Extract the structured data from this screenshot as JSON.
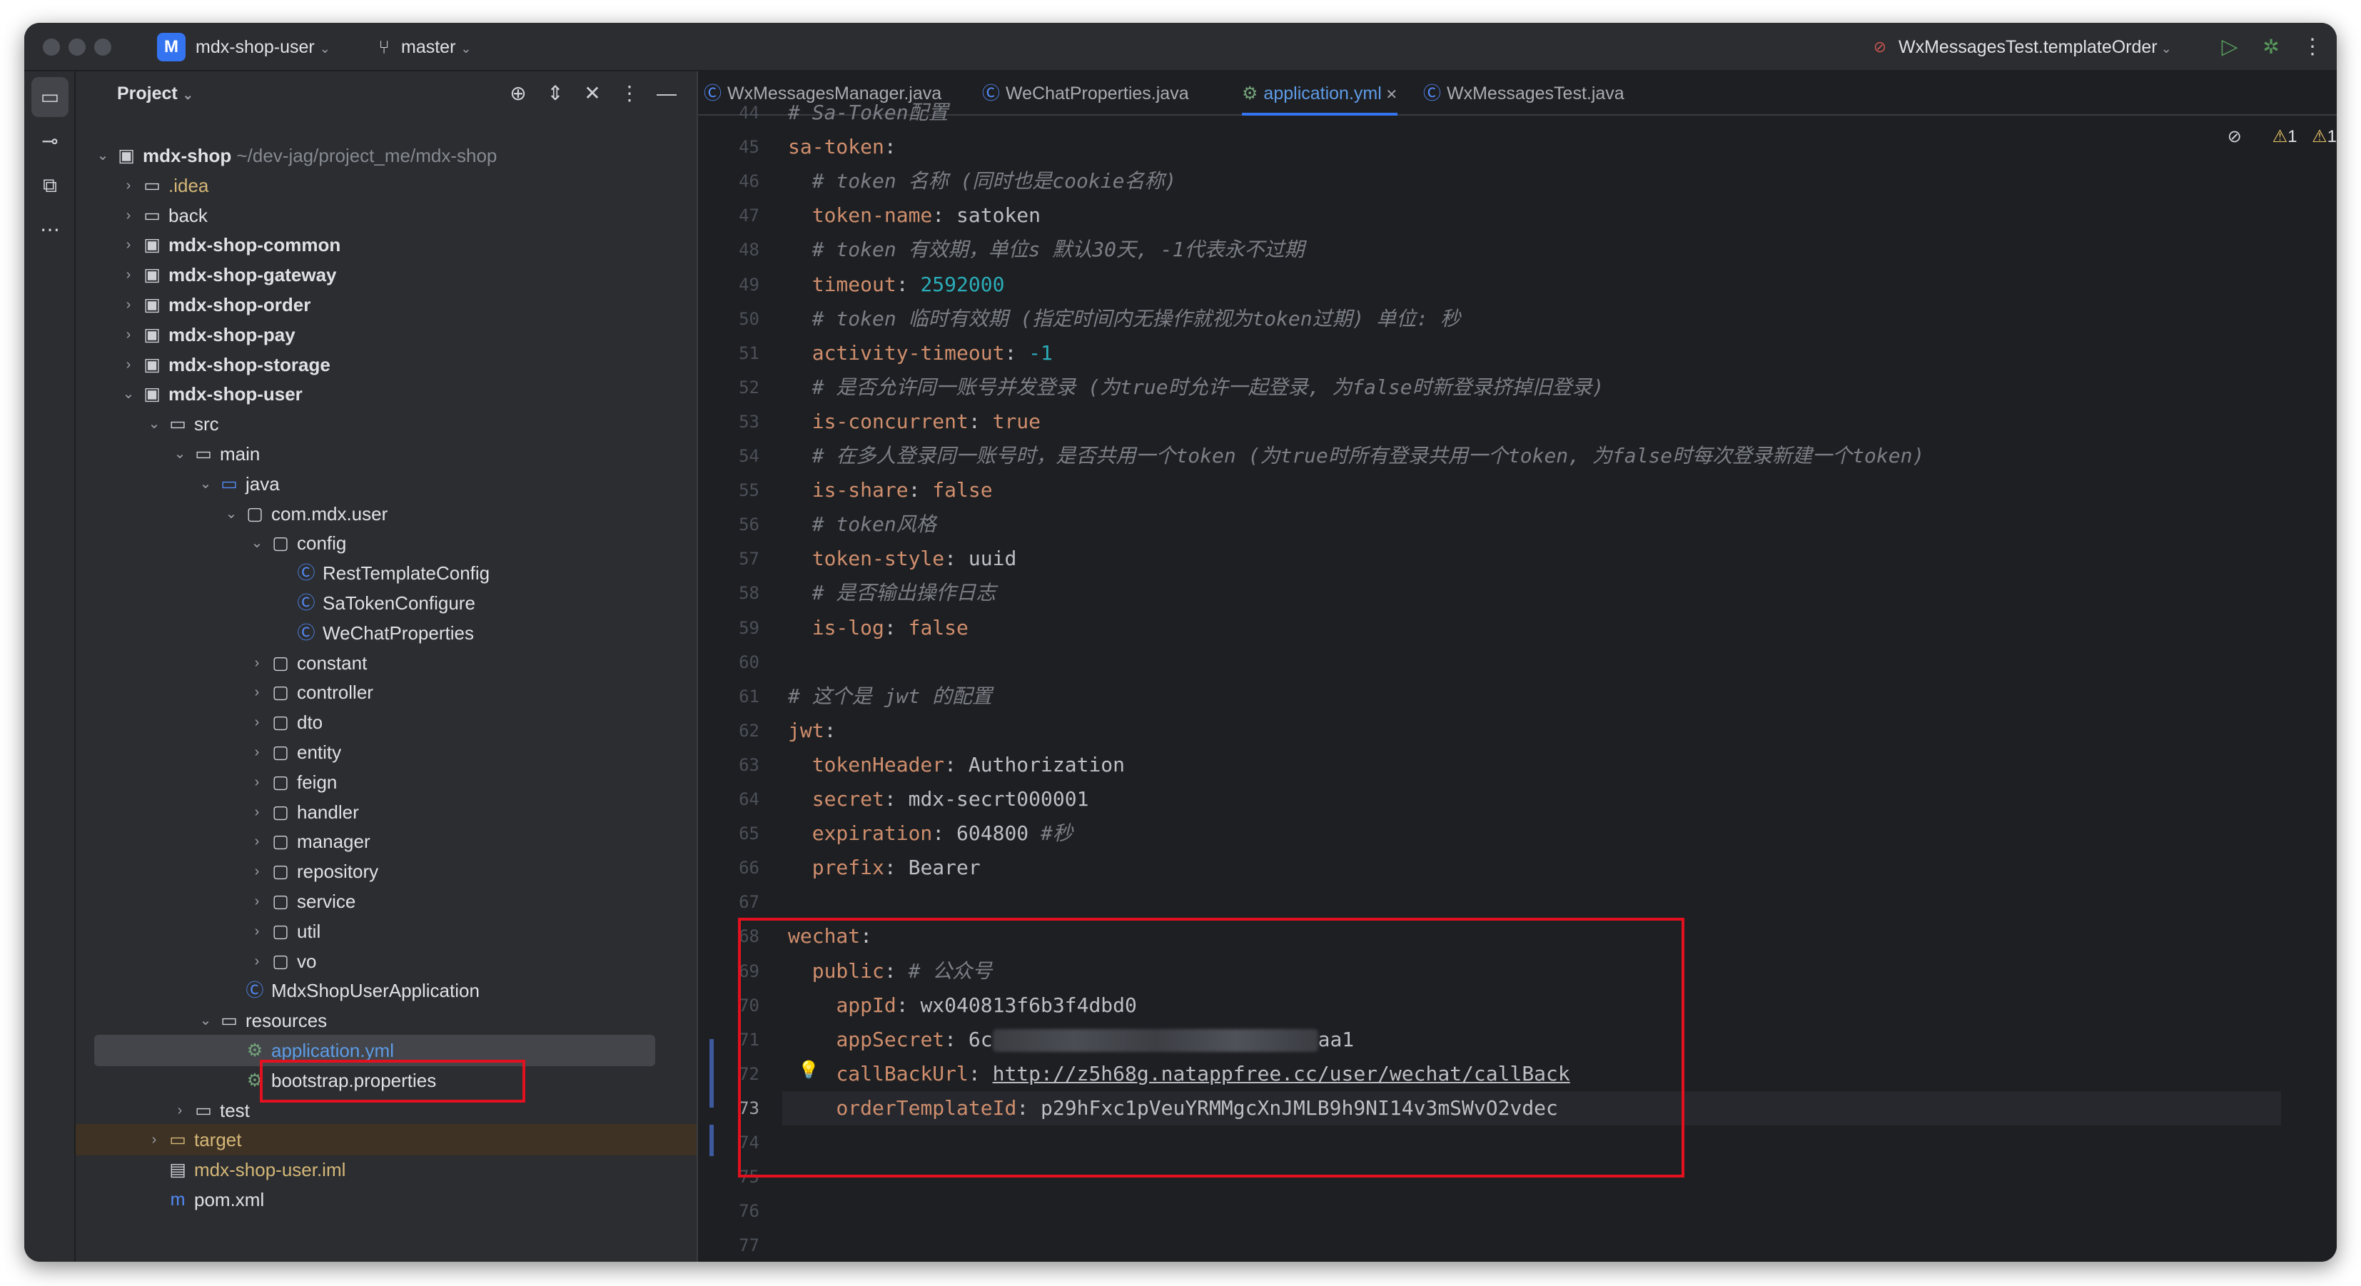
{
  "titlebar": {
    "project_badge": "M",
    "project_name": "mdx-shop-user",
    "branch": "master",
    "run_config": "WxMessagesTest.templateOrder",
    "icons": [
      "chevron-down-icon",
      "branch-icon",
      "run-icon",
      "debug-icon",
      "more-icon"
    ]
  },
  "project_panel": {
    "title": "Project",
    "tree": [
      {
        "label": "mdx-shop",
        "hint": "~/dev-jag/project_me/mdx-shop",
        "bold": true,
        "color": "#dfe1e5",
        "icon": "module-folder-icon",
        "expanded": true
      },
      {
        "label": ".idea",
        "color": "#d5b778",
        "icon": "folder-icon",
        "collapsed": true
      },
      {
        "label": "back",
        "color": "#dfe1e5",
        "icon": "folder-icon",
        "collapsed": true
      },
      {
        "label": "mdx-shop-common",
        "bold": true,
        "color": "#dfe1e5",
        "icon": "module-folder-icon",
        "collapsed": true
      },
      {
        "label": "mdx-shop-gateway",
        "bold": true,
        "color": "#dfe1e5",
        "icon": "module-folder-icon",
        "collapsed": true
      },
      {
        "label": "mdx-shop-order",
        "bold": true,
        "color": "#dfe1e5",
        "icon": "module-folder-icon",
        "collapsed": true
      },
      {
        "label": "mdx-shop-pay",
        "bold": true,
        "color": "#dfe1e5",
        "icon": "module-folder-icon",
        "collapsed": true
      },
      {
        "label": "mdx-shop-storage",
        "bold": true,
        "color": "#dfe1e5",
        "icon": "module-folder-icon",
        "collapsed": true
      },
      {
        "label": "mdx-shop-user",
        "bold": true,
        "color": "#dfe1e5",
        "icon": "module-folder-icon",
        "expanded": true
      },
      {
        "label": "src",
        "color": "#dfe1e5",
        "icon": "folder-icon",
        "expanded": true
      },
      {
        "label": "main",
        "color": "#dfe1e5",
        "icon": "folder-icon",
        "expanded": true
      },
      {
        "label": "java",
        "color": "#dfe1e5",
        "icon": "source-folder-icon",
        "expanded": true
      },
      {
        "label": "com.mdx.user",
        "color": "#dfe1e5",
        "icon": "package-icon",
        "expanded": true
      },
      {
        "label": "config",
        "color": "#dfe1e5",
        "icon": "package-icon",
        "expanded": true
      },
      {
        "label": "RestTemplateConfig",
        "color": "#dfe1e5",
        "icon": "class-icon"
      },
      {
        "label": "SaTokenConfigure",
        "color": "#dfe1e5",
        "icon": "class-icon"
      },
      {
        "label": "WeChatProperties",
        "color": "#dfe1e5",
        "icon": "class-icon"
      },
      {
        "label": "constant",
        "color": "#dfe1e5",
        "icon": "package-icon",
        "collapsed": true
      },
      {
        "label": "controller",
        "color": "#dfe1e5",
        "icon": "package-icon",
        "collapsed": true
      },
      {
        "label": "dto",
        "color": "#dfe1e5",
        "icon": "package-icon",
        "collapsed": true
      },
      {
        "label": "entity",
        "color": "#dfe1e5",
        "icon": "package-icon",
        "collapsed": true
      },
      {
        "label": "feign",
        "color": "#dfe1e5",
        "icon": "package-icon",
        "collapsed": true
      },
      {
        "label": "handler",
        "color": "#dfe1e5",
        "icon": "package-icon",
        "collapsed": true
      },
      {
        "label": "manager",
        "color": "#dfe1e5",
        "icon": "package-icon",
        "collapsed": true
      },
      {
        "label": "repository",
        "color": "#dfe1e5",
        "icon": "package-icon",
        "collapsed": true
      },
      {
        "label": "service",
        "color": "#dfe1e5",
        "icon": "package-icon",
        "collapsed": true
      },
      {
        "label": "util",
        "color": "#dfe1e5",
        "icon": "package-icon",
        "collapsed": true
      },
      {
        "label": "vo",
        "color": "#dfe1e5",
        "icon": "package-icon",
        "collapsed": true
      },
      {
        "label": "MdxShopUserApplication",
        "color": "#dfe1e5",
        "icon": "spring-app-icon"
      },
      {
        "label": "resources",
        "color": "#dfe1e5",
        "icon": "resources-folder-icon",
        "expanded": true
      },
      {
        "label": "application.yml",
        "color": "#5e9be6",
        "icon": "yaml-file-icon",
        "selected": true
      },
      {
        "label": "bootstrap.properties",
        "color": "#dfe1e5",
        "icon": "properties-file-icon"
      },
      {
        "label": "test",
        "color": "#dfe1e5",
        "icon": "folder-icon",
        "collapsed": true
      },
      {
        "label": "target",
        "color": "#d5b778",
        "icon": "excluded-folder-icon",
        "collapsed": true,
        "excluded": true
      },
      {
        "label": "mdx-shop-user.iml",
        "color": "#d5b778",
        "icon": "iml-file-icon"
      },
      {
        "label": "pom.xml",
        "color": "#dfe1e5",
        "icon": "maven-icon"
      }
    ]
  },
  "tabs": [
    {
      "label": "WxMessagesManager.java",
      "icon": "class-icon"
    },
    {
      "label": "WeChatProperties.java",
      "icon": "class-icon"
    },
    {
      "label": "application.yml",
      "icon": "yaml-file-icon",
      "active": true
    },
    {
      "label": "WxMessagesTest.java",
      "icon": "class-icon"
    }
  ],
  "inspections": {
    "warnings_a": "1",
    "warnings_b": "1"
  },
  "editor": {
    "lines": [
      {
        "n": "44",
        "parts": [
          [
            "c",
            "# Sa-Token配置"
          ]
        ]
      },
      {
        "n": "45",
        "parts": [
          [
            "k",
            "sa-token"
          ],
          [
            "v",
            ":"
          ]
        ]
      },
      {
        "n": "46",
        "parts": [
          [
            "v",
            "  "
          ],
          [
            "c",
            "# token 名称 (同时也是cookie名称)"
          ]
        ]
      },
      {
        "n": "47",
        "parts": [
          [
            "v",
            "  "
          ],
          [
            "k",
            "token-name"
          ],
          [
            "v",
            ": satoken"
          ]
        ]
      },
      {
        "n": "48",
        "parts": [
          [
            "v",
            "  "
          ],
          [
            "c",
            "# token 有效期，单位s 默认30天, -1代表永不过期"
          ]
        ]
      },
      {
        "n": "49",
        "parts": [
          [
            "v",
            "  "
          ],
          [
            "k",
            "timeout"
          ],
          [
            "v",
            ": "
          ],
          [
            "n",
            "2592000"
          ]
        ]
      },
      {
        "n": "50",
        "parts": [
          [
            "v",
            "  "
          ],
          [
            "c",
            "# token 临时有效期 (指定时间内无操作就视为token过期) 单位: 秒"
          ]
        ]
      },
      {
        "n": "51",
        "parts": [
          [
            "v",
            "  "
          ],
          [
            "k",
            "activity-timeout"
          ],
          [
            "v",
            ": "
          ],
          [
            "n",
            "-1"
          ]
        ]
      },
      {
        "n": "52",
        "parts": [
          [
            "v",
            "  "
          ],
          [
            "c",
            "# 是否允许同一账号并发登录 (为true时允许一起登录, 为false时新登录挤掉旧登录)"
          ]
        ]
      },
      {
        "n": "53",
        "parts": [
          [
            "v",
            "  "
          ],
          [
            "k",
            "is-concurrent"
          ],
          [
            "v",
            ": "
          ],
          [
            "k",
            "true"
          ]
        ]
      },
      {
        "n": "54",
        "parts": [
          [
            "v",
            "  "
          ],
          [
            "c",
            "# 在多人登录同一账号时，是否共用一个token (为true时所有登录共用一个token, 为false时每次登录新建一个token)"
          ]
        ]
      },
      {
        "n": "55",
        "parts": [
          [
            "v",
            "  "
          ],
          [
            "k",
            "is-share"
          ],
          [
            "v",
            ": "
          ],
          [
            "k",
            "false"
          ]
        ]
      },
      {
        "n": "56",
        "parts": [
          [
            "v",
            "  "
          ],
          [
            "c",
            "# token风格"
          ]
        ]
      },
      {
        "n": "57",
        "parts": [
          [
            "v",
            "  "
          ],
          [
            "k",
            "token-style"
          ],
          [
            "v",
            ": uuid"
          ]
        ]
      },
      {
        "n": "58",
        "parts": [
          [
            "v",
            "  "
          ],
          [
            "c",
            "# 是否输出操作日志"
          ]
        ]
      },
      {
        "n": "59",
        "parts": [
          [
            "v",
            "  "
          ],
          [
            "k",
            "is-log"
          ],
          [
            "v",
            ": "
          ],
          [
            "k",
            "false"
          ]
        ]
      },
      {
        "n": "60",
        "parts": []
      },
      {
        "n": "61",
        "parts": [
          [
            "c",
            "# 这个是 jwt 的配置"
          ]
        ]
      },
      {
        "n": "62",
        "parts": [
          [
            "k",
            "jwt"
          ],
          [
            "v",
            ":"
          ]
        ]
      },
      {
        "n": "63",
        "parts": [
          [
            "v",
            "  "
          ],
          [
            "k",
            "tokenHeader"
          ],
          [
            "v",
            ": Authorization"
          ]
        ]
      },
      {
        "n": "64",
        "parts": [
          [
            "v",
            "  "
          ],
          [
            "k",
            "secret"
          ],
          [
            "v",
            ": mdx-secrt000001"
          ]
        ]
      },
      {
        "n": "65",
        "parts": [
          [
            "v",
            "  "
          ],
          [
            "k",
            "expiration"
          ],
          [
            "v",
            ": 604800 "
          ],
          [
            "c",
            "#秒"
          ]
        ]
      },
      {
        "n": "66",
        "parts": [
          [
            "v",
            "  "
          ],
          [
            "k",
            "prefix"
          ],
          [
            "v",
            ": Bearer"
          ]
        ]
      },
      {
        "n": "67",
        "parts": []
      },
      {
        "n": "68",
        "parts": [
          [
            "k",
            "wechat"
          ],
          [
            "v",
            ":"
          ]
        ]
      },
      {
        "n": "69",
        "parts": [
          [
            "v",
            "  "
          ],
          [
            "k",
            "public"
          ],
          [
            "v",
            ": "
          ],
          [
            "c",
            "# 公众号"
          ]
        ]
      },
      {
        "n": "70",
        "parts": [
          [
            "v",
            "    "
          ],
          [
            "k",
            "appId"
          ],
          [
            "v",
            ": wx040813f6b3f4dbd0"
          ]
        ]
      },
      {
        "n": "71",
        "parts": [
          [
            "v",
            "    "
          ],
          [
            "k",
            "appSecret"
          ],
          [
            "v",
            ": 6c"
          ],
          [
            "blur",
            ""
          ],
          [
            "v",
            "aa1"
          ]
        ]
      },
      {
        "n": "72",
        "parts": [
          [
            "v",
            "    "
          ],
          [
            "k",
            "callBackUrl"
          ],
          [
            "v",
            ": "
          ],
          [
            "lnk",
            "http://z5h68g.natappfree.cc/user/wechat/callBack"
          ]
        ]
      },
      {
        "n": "73",
        "parts": [
          [
            "v",
            "    "
          ],
          [
            "k",
            "orderTemplateId"
          ],
          [
            "v",
            ": p29hFxc1pVeuYRMMgcXnJMLB9h9NI14v3mSWvO2vdec"
          ]
        ],
        "current": true
      },
      {
        "n": "74",
        "parts": []
      },
      {
        "n": "75",
        "parts": []
      },
      {
        "n": "76",
        "parts": []
      },
      {
        "n": "77",
        "parts": []
      }
    ]
  },
  "colors": {
    "accent": "#3574f0",
    "highlight_box": "#e3111f",
    "yaml_key": "#cf8e6d",
    "comment": "#7a7e85",
    "number": "#2aacb8"
  }
}
